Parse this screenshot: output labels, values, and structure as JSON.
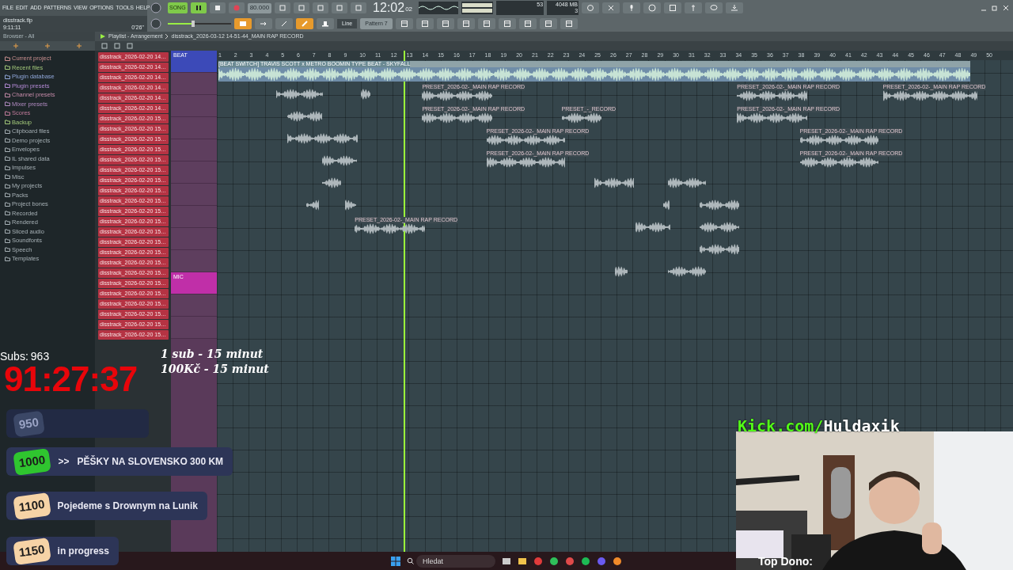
{
  "menu": [
    "FILE",
    "EDIT",
    "ADD",
    "PATTERNS",
    "VIEW",
    "OPTIONS",
    "TOOLS",
    "HELP"
  ],
  "project": {
    "file": "disstrack.flp",
    "time": "9:11:11",
    "hint": "0'26''"
  },
  "transport": {
    "mode": "SONG",
    "song_mode": true,
    "tempo": "80.000",
    "time_main": "12:02",
    "time_sub": "02",
    "cpu": "53",
    "memory": "4048 MB",
    "polyphony": "3",
    "snap": "Line",
    "pattern": "Pattern 7"
  },
  "browser": {
    "title": "Browser - All",
    "items": [
      {
        "label": "Current project",
        "color": "#c98f8f"
      },
      {
        "label": "Recent files",
        "color": "#a3c97a"
      },
      {
        "label": "Plugin database",
        "color": "#8fa6d8"
      },
      {
        "label": "Plugin presets",
        "color": "#b48ad6"
      },
      {
        "label": "Channel presets",
        "color": "#c48aa8"
      },
      {
        "label": "Mixer presets",
        "color": "#b08ac0"
      },
      {
        "label": "Scores",
        "color": "#c07a9a"
      },
      {
        "label": "Backup",
        "color": "#a3c97a"
      },
      {
        "label": "Clipboard files",
        "color": "#a6b0b5"
      },
      {
        "label": "Demo projects",
        "color": "#a6b0b5"
      },
      {
        "label": "Envelopes",
        "color": "#a6b0b5"
      },
      {
        "label": "IL shared data",
        "color": "#a6b0b5"
      },
      {
        "label": "Impulses",
        "color": "#a6b0b5"
      },
      {
        "label": "Misc",
        "color": "#a6b0b5"
      },
      {
        "label": "My projects",
        "color": "#a6b0b5"
      },
      {
        "label": "Packs",
        "color": "#a6b0b5"
      },
      {
        "label": "Project bones",
        "color": "#a6b0b5"
      },
      {
        "label": "Recorded",
        "color": "#a6b0b5"
      },
      {
        "label": "Rendered",
        "color": "#a6b0b5"
      },
      {
        "label": "Sliced audio",
        "color": "#a6b0b5"
      },
      {
        "label": "Soundfonts",
        "color": "#a6b0b5"
      },
      {
        "label": "Speech",
        "color": "#a6b0b5"
      },
      {
        "label": "Templates",
        "color": "#a6b0b5"
      }
    ]
  },
  "playlist": {
    "title": "Playlist - Arrangement",
    "path": "disstrack_2026-03-12 14-51-44_MAIN RAP RECORD"
  },
  "clip_list": [
    "disstrack_2026-02-20 14…",
    "disstrack_2026-02-20 14…",
    "disstrack_2026-02-20 14…",
    "disstrack_2026-02-20 14…",
    "disstrack_2026-02-20 14…",
    "disstrack_2026-02-20 14…",
    "disstrack_2026-02-20 15…",
    "disstrack_2026-02-20 15…",
    "disstrack_2026-02-20 15…",
    "disstrack_2026-02-20 15…",
    "disstrack_2026-02-20 15…",
    "disstrack_2026-02-20 15…",
    "disstrack_2026-02-20 15…",
    "disstrack_2026-02-20 15…",
    "disstrack_2026-02-20 15…",
    "disstrack_2026-02-20 15…",
    "disstrack_2026-02-20 15…",
    "disstrack_2026-02-20 15…",
    "disstrack_2026-02-20 15…",
    "disstrack_2026-02-20 15…",
    "disstrack_2026-02-20 15…",
    "disstrack_2026-02-20 15…",
    "disstrack_2026-02-20 15…",
    "disstrack_2026-02-20 15…",
    "disstrack_2026-02-20 15…",
    "disstrack_2026-02-20 15…",
    "disstrack_2026-02-20 15…",
    "disstrack_2026-02-20 15…"
  ],
  "tracks": [
    {
      "name": "BEAT",
      "color": "#3c4ab8"
    },
    {
      "name": "MIC",
      "color": "#c02fa8"
    }
  ],
  "ruler": [
    "1",
    "2",
    "3",
    "4",
    "5",
    "6",
    "7",
    "8",
    "9",
    "10",
    "11",
    "12",
    "13",
    "14",
    "15",
    "16",
    "17",
    "18",
    "19",
    "20",
    "21",
    "22",
    "23",
    "24",
    "25",
    "26",
    "27",
    "28",
    "29",
    "30",
    "31",
    "32",
    "33",
    "34",
    "35",
    "36",
    "37",
    "38",
    "39",
    "40",
    "41",
    "42",
    "43",
    "44",
    "45",
    "46",
    "47",
    "48",
    "49",
    "50"
  ],
  "beat_clip": {
    "label": "[BEAT SWITCH] TRAVIS SCOTT x METRO BOOMIN TYPE BEAT - SKYFALL"
  },
  "clips": [
    {
      "label": "PRESET_2026-02-_MAIN RAP RECORD"
    },
    {
      "label": "PRESET_2026-02-_MAIN RAP RECORD"
    },
    {
      "label": "PRESET_2026-02-_MAIN RAP RECORD"
    },
    {
      "label": "PRESET_2026-02-_MAIN RAP RECORD"
    },
    {
      "label": "PRESET_-_RECORD"
    },
    {
      "label": "PRESET_2026-02-_MAIN RAP RECORD"
    },
    {
      "label": "PRESET_2026-02-_MAIN RAP RECORD"
    },
    {
      "label": "PRESET_2026-02-_MAIN RAP RECORD"
    },
    {
      "label": "PRESET_2026-02-_MAIN RAP RECORD"
    },
    {
      "label": "PRESET_2026-02-_MAIN RAP RECORD"
    },
    {
      "label": "PRESET_2026-02-_MAIN RAP RECORD"
    }
  ],
  "overlay": {
    "subs_label": "Subs:",
    "subs": "963",
    "timer": "91:27:37",
    "rates": [
      "1 sub - 15 minut",
      "100Kč - 15 minut"
    ],
    "goals": [
      {
        "amount": "950",
        "color": "#3b4766",
        "done": true
      },
      {
        "amount": "1000",
        "color": "#2fc52f",
        "done": false,
        "prefix": ">>",
        "text": "PĚŠKY NA SLOVENSKO 300 KM"
      },
      {
        "amount": "1100",
        "color": "#f6d3a6",
        "done": false,
        "text": "Pojedeme s Drownym na Lunik"
      },
      {
        "amount": "1150",
        "color": "#f6d3a6",
        "done": false,
        "text": "in progress"
      }
    ],
    "webcam": {
      "kind": "picture",
      "site": "Kick.com/",
      "channel": "Huldaxik",
      "top_dono": "Top Dono:"
    }
  },
  "taskbar": {
    "search": {
      "placeholder": "Hledat"
    }
  }
}
